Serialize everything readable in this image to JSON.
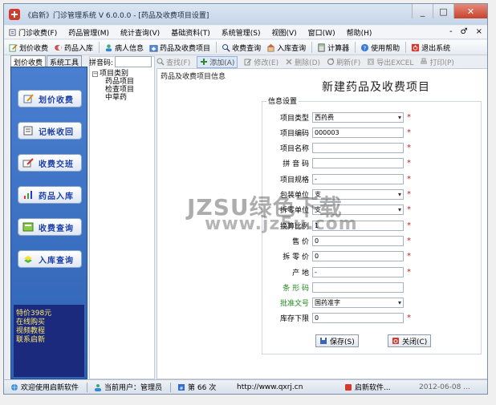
{
  "window": {
    "title": "《启新》门诊管理系统 V 6.0.0.0 - [药品及收费项目设置]",
    "minimize": "_",
    "maximize": "□",
    "close": "✕"
  },
  "menu": {
    "items": [
      {
        "label": "门诊收费(F)"
      },
      {
        "label": "药品管理(M)"
      },
      {
        "label": "统计查询(V)"
      },
      {
        "label": "基础资料(T)"
      },
      {
        "label": "系统管理(S)"
      },
      {
        "label": "视图(V)"
      },
      {
        "label": "窗口(W)"
      },
      {
        "label": "帮助(H)"
      }
    ],
    "right_controls": [
      "-",
      "♂",
      "×"
    ]
  },
  "toolbar": {
    "items": [
      {
        "label": "划价收费"
      },
      {
        "label": "药品入库"
      },
      {
        "label": "病人信息"
      },
      {
        "label": "药品及收费项目"
      },
      {
        "label": "收费查询"
      },
      {
        "label": "入库查询"
      },
      {
        "label": "计算器"
      },
      {
        "label": "使用帮助"
      },
      {
        "label": "退出系统"
      }
    ]
  },
  "left_panel": {
    "tabs": [
      {
        "label": "划价收费"
      },
      {
        "label": "系统工具"
      }
    ],
    "nav": [
      {
        "label": "划价收费"
      },
      {
        "label": "记帐收回"
      },
      {
        "label": "收费交班"
      },
      {
        "label": "药品入库"
      },
      {
        "label": "收费查询"
      },
      {
        "label": "入库查询"
      }
    ],
    "promo": [
      "特价398元",
      "在线购买",
      "视频教程",
      "联系启新"
    ]
  },
  "search": {
    "label": "拼音码:",
    "value": ""
  },
  "tree": {
    "root": "项目类别",
    "children": [
      "药品项目",
      "检查项目",
      "中草药"
    ]
  },
  "data_toolbar": {
    "items": [
      {
        "label": "查找(F)"
      },
      {
        "label": "添加(A)"
      },
      {
        "label": "修改(E)"
      },
      {
        "label": "删除(D)"
      },
      {
        "label": "刷新(F)"
      },
      {
        "label": "导出EXCEL"
      },
      {
        "label": "打印(P)"
      }
    ]
  },
  "main": {
    "caption": "药品及收费项目信息",
    "form_title": "新建药品及收费项目",
    "group_title": "信息设置",
    "fields": [
      {
        "label": "项目类型",
        "value": "西药费",
        "select": true,
        "required": true
      },
      {
        "label": "项目编码",
        "value": "000003",
        "select": false,
        "required": true
      },
      {
        "label": "项目名称",
        "value": "",
        "select": false,
        "required": true
      },
      {
        "label": "拼 音 码",
        "value": "",
        "select": false,
        "required": true
      },
      {
        "label": "项目规格",
        "value": "-",
        "select": false,
        "required": true
      },
      {
        "label": "包装单位",
        "value": "支",
        "select": true,
        "required": true
      },
      {
        "label": "拆零单位",
        "value": "支",
        "select": true,
        "required": true
      },
      {
        "label": "换算比例",
        "value": "1",
        "select": false,
        "required": true
      },
      {
        "label": "售    价",
        "value": "0",
        "select": false,
        "required": true
      },
      {
        "label": "拆 零 价",
        "value": "0",
        "select": false,
        "required": true
      },
      {
        "label": "产    地",
        "value": "-",
        "select": false,
        "required": true
      },
      {
        "label": "条 形 码",
        "value": "",
        "select": false,
        "required": false,
        "green": true
      },
      {
        "label": "批准文号",
        "value": "国药准字",
        "select": true,
        "required": false,
        "green": true
      },
      {
        "label": "库存下限",
        "value": "0",
        "select": false,
        "required": true
      }
    ],
    "save_label": "保存(S)",
    "close_label": "关闭(C)"
  },
  "watermark": {
    "line1": "JZSU绿色下载",
    "line2": "www.jz5u.com"
  },
  "status": {
    "welcome": "欢迎使用启新软件",
    "user": "当前用户：管理员",
    "count": "第 66 次",
    "url": "http://www.qxrj.cn",
    "company": "启新软件...",
    "date": "2012-06-08 ..."
  },
  "colors": {
    "nav_bg": "#2f62b3",
    "nav_label": "#1c3fa8",
    "required": "#d02020",
    "promo_bg": "#1b2a7d",
    "promo_text": "#ffe86a"
  }
}
